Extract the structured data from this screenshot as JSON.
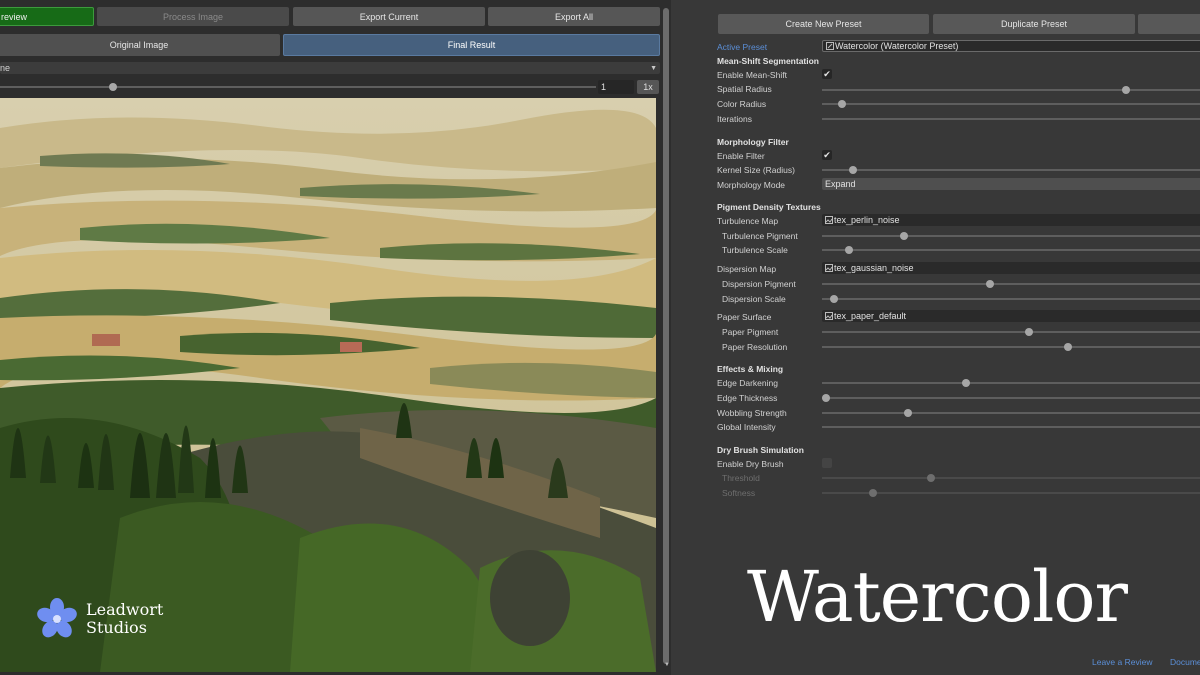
{
  "toolbar": {
    "preview_label": "review",
    "process_label": "Process Image",
    "export_current_label": "Export Current",
    "export_all_label": "Export All"
  },
  "view_tabs": {
    "original": "Original Image",
    "final": "Final Result"
  },
  "source_dropdown": {
    "value": "ne"
  },
  "zoom": {
    "value": "1",
    "reset_label": "1x",
    "slider_fraction": 0.19
  },
  "logo": {
    "line1": "Leadwort",
    "line2": "Studios"
  },
  "preset_buttons": {
    "create": "Create New Preset",
    "duplicate": "Duplicate Preset"
  },
  "active_preset": {
    "label": "Active Preset",
    "value": "Watercolor (Watercolor Preset)"
  },
  "mean_shift": {
    "header": "Mean-Shift Segmentation",
    "enable_label": "Enable Mean-Shift",
    "enabled": true,
    "spatial_label": "Spatial Radius",
    "spatial_value": 0.78,
    "color_label": "Color Radius",
    "color_value": 0.05,
    "iterations_label": "Iterations"
  },
  "morphology": {
    "header": "Morphology Filter",
    "enable_label": "Enable Filter",
    "enabled": true,
    "kernel_label": "Kernel Size (Radius)",
    "kernel_value": 0.08,
    "mode_label": "Morphology Mode",
    "mode_value": "Expand"
  },
  "pigment": {
    "header": "Pigment Density Textures",
    "turbulence_map_label": "Turbulence Map",
    "turbulence_map_value": "tex_perlin_noise",
    "turbulence_pigment_label": "Turbulence Pigment",
    "turbulence_pigment_value": 0.21,
    "turbulence_scale_label": "Turbulence Scale",
    "turbulence_scale_value": 0.07,
    "dispersion_map_label": "Dispersion Map",
    "dispersion_map_value": "tex_gaussian_noise",
    "dispersion_pigment_label": "Dispersion Pigment",
    "dispersion_pigment_value": 0.43,
    "dispersion_scale_label": "Dispersion Scale",
    "dispersion_scale_value": 0.03,
    "paper_surface_label": "Paper Surface",
    "paper_surface_value": "tex_paper_default",
    "paper_pigment_label": "Paper Pigment",
    "paper_pigment_value": 0.53,
    "paper_resolution_label": "Paper Resolution",
    "paper_resolution_value": 0.63
  },
  "effects": {
    "header": "Effects & Mixing",
    "edge_darkening_label": "Edge Darkening",
    "edge_darkening_value": 0.37,
    "edge_thickness_label": "Edge Thickness",
    "edge_thickness_value": 0.01,
    "wobbling_label": "Wobbling Strength",
    "wobbling_value": 0.22,
    "global_label": "Global Intensity"
  },
  "dry_brush": {
    "header": "Dry Brush Simulation",
    "enable_label": "Enable Dry Brush",
    "enabled": false,
    "threshold_label": "Threshold",
    "threshold_value": 0.28,
    "softness_label": "Softness",
    "softness_value": 0.13
  },
  "banner_title": "Watercolor",
  "footer": {
    "review": "Leave a Review",
    "docs": "Docume"
  },
  "colors": {
    "accent": "#5b8fd8",
    "preview_green": "#176b17",
    "final_tab": "#46607e"
  }
}
